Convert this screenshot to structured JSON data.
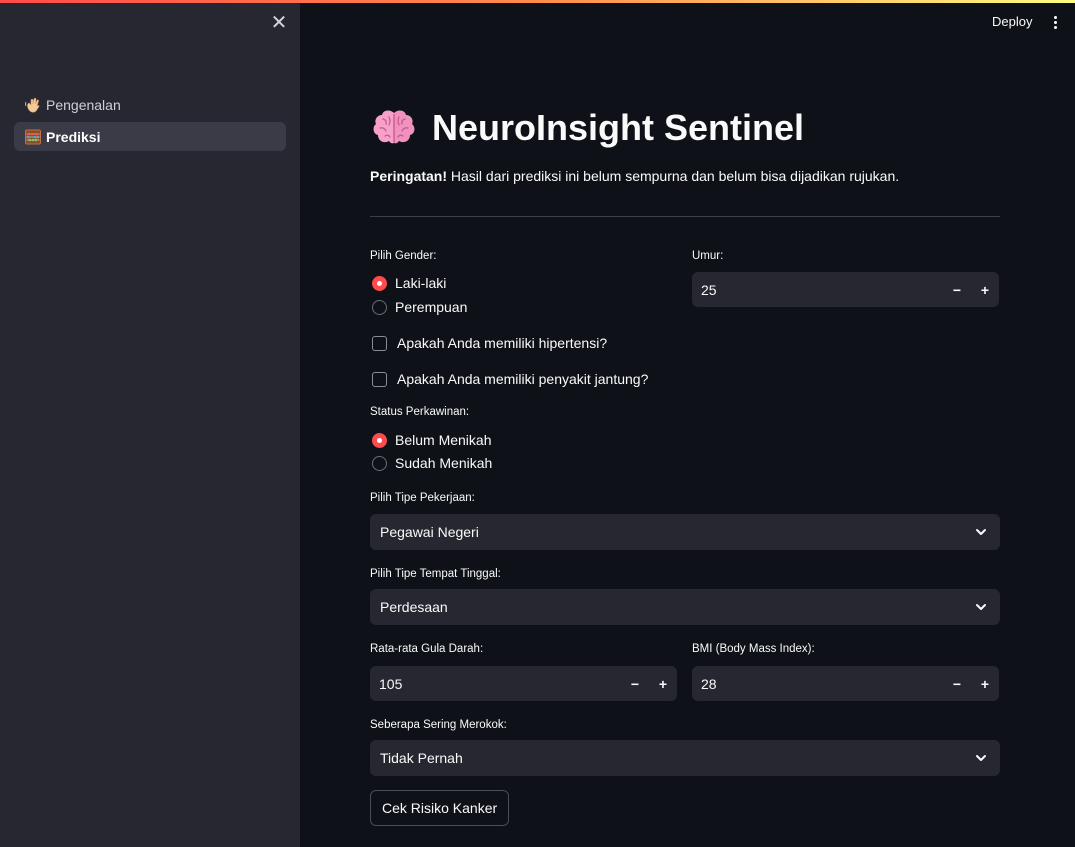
{
  "app": {
    "deploy_label": "Deploy",
    "accent_color": "#ff4b4b"
  },
  "sidebar": {
    "items": [
      {
        "label": "Pengenalan",
        "icon": "waving-hand-icon",
        "active": false
      },
      {
        "label": "Prediksi",
        "icon": "abacus-icon",
        "active": true
      }
    ]
  },
  "main": {
    "title": "NeuroInsight Sentinel",
    "title_icon": "brain-icon",
    "warning_bold": "Peringatan!",
    "warning_text": " Hasil dari prediksi ini belum sempurna dan belum bisa dijadikan rujukan."
  },
  "form": {
    "gender": {
      "label": "Pilih Gender:",
      "options": [
        "Laki-laki",
        "Perempuan"
      ],
      "selected": "Laki-laki"
    },
    "age": {
      "label": "Umur:",
      "value": "25"
    },
    "hypertension": {
      "label": "Apakah Anda memiliki hipertensi?",
      "checked": false
    },
    "heart_disease": {
      "label": "Apakah Anda memiliki penyakit jantung?",
      "checked": false
    },
    "marital": {
      "label": "Status Perkawinan:",
      "options": [
        "Belum Menikah",
        "Sudah Menikah"
      ],
      "selected": "Belum Menikah"
    },
    "work_type": {
      "label": "Pilih Tipe Pekerjaan:",
      "value": "Pegawai Negeri"
    },
    "residence": {
      "label": "Pilih Tipe Tempat Tinggal:",
      "value": "Perdesaan"
    },
    "glucose": {
      "label": "Rata-rata Gula Darah:",
      "value": "105"
    },
    "bmi": {
      "label": "BMI (Body Mass Index):",
      "value": "28"
    },
    "smoking": {
      "label": "Seberapa Sering Merokok:",
      "value": "Tidak Pernah"
    },
    "minus": "−",
    "plus": "+",
    "submit_label": "Cek Risiko Kanker"
  }
}
